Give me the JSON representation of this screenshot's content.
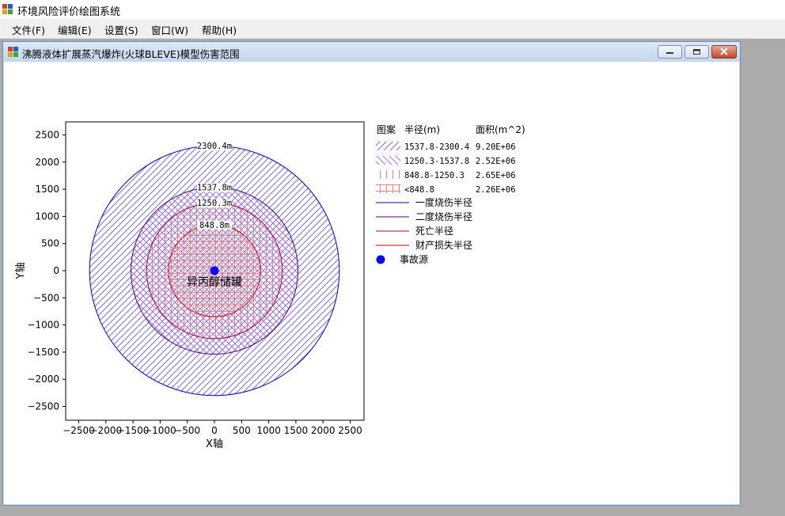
{
  "app": {
    "title": "环境风险评价绘图系统"
  },
  "menu": [
    "文件(F)",
    "编辑(E)",
    "设置(S)",
    "窗口(W)",
    "帮助(H)"
  ],
  "window": {
    "title": "沸腾液体扩展蒸汽爆炸(火球BLEVE)模型伤害范围"
  },
  "chart_data": {
    "type": "concentric-circles",
    "xlabel": "X轴",
    "ylabel": "Y轴",
    "xlim": [
      -2750,
      2750
    ],
    "ylim": [
      -2750,
      2750
    ],
    "xticks": [
      -2500,
      -2000,
      -1500,
      -1000,
      -500,
      0,
      500,
      1000,
      1500,
      2000,
      2500
    ],
    "yticks": [
      2500,
      2000,
      1500,
      1000,
      500,
      0,
      -500,
      -1000,
      -1500,
      -2000,
      -2500
    ],
    "circles": [
      {
        "radius": 2300.4,
        "label": "2300.4m",
        "stroke": "#0000cc",
        "pattern": "diag-fwd",
        "hatch": "#7070e0"
      },
      {
        "radius": 1537.8,
        "label": "1537.8m",
        "stroke": "#4b0082",
        "pattern": "diag-back",
        "hatch": "#b070d0"
      },
      {
        "radius": 1250.3,
        "label": "1250.3m",
        "stroke": "#b00040",
        "pattern": "vert",
        "hatch": "#e08090"
      },
      {
        "radius": 848.8,
        "label": "848.8m",
        "stroke": "#dd0000",
        "pattern": "cross",
        "hatch": "#f08080"
      }
    ],
    "source": {
      "x": 0,
      "y": 0,
      "label": "异丙醇储罐",
      "color": "#0000ff"
    }
  },
  "legend": {
    "headers": {
      "pattern": "图案",
      "radius": "半径(m)",
      "area": "面积(m^2)"
    },
    "rows": [
      {
        "range": "1537.8-2300.4",
        "area": "9.20E+06"
      },
      {
        "range": "1250.3-1537.8",
        "area": "2.52E+06"
      },
      {
        "range": "848.8-1250.3",
        "area": "2.65E+06"
      },
      {
        "range": "<848.8",
        "area": "2.26E+06"
      }
    ],
    "lines": [
      {
        "label": "一度烧伤半径",
        "color": "#0000cc"
      },
      {
        "label": "二度烧伤半径",
        "color": "#4b0082"
      },
      {
        "label": "死亡半径",
        "color": "#b00040"
      },
      {
        "label": "财产损失半径",
        "color": "#dd0000"
      }
    ],
    "source_label": "事故源"
  }
}
